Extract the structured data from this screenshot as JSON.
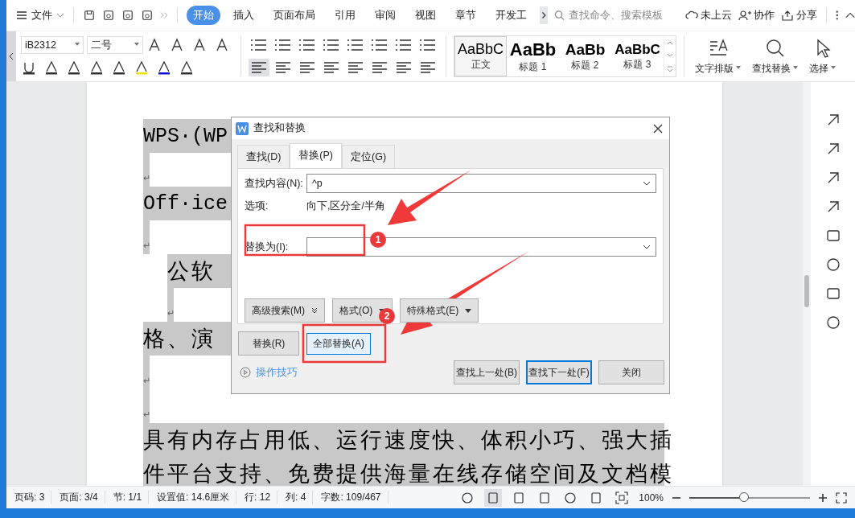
{
  "menu_bar": {
    "file_menu": "文件",
    "tabs": [
      {
        "label": "开始",
        "selected": true
      },
      {
        "label": "插入",
        "selected": false
      },
      {
        "label": "页面布局",
        "selected": false
      },
      {
        "label": "引用",
        "selected": false
      },
      {
        "label": "审阅",
        "selected": false
      },
      {
        "label": "视图",
        "selected": false
      },
      {
        "label": "章节",
        "selected": false
      },
      {
        "label": "开发工",
        "selected": false
      }
    ],
    "search": {
      "placeholder": "查找命令、搜索模板"
    },
    "actions": [
      {
        "kind": "cloud",
        "label": "未上云"
      },
      {
        "kind": "collab",
        "label": "协作"
      },
      {
        "kind": "share",
        "label": "分享"
      }
    ]
  },
  "ribbon": {
    "font_name": "iB2312",
    "font_size": "二号",
    "styles": [
      {
        "kind": "body",
        "sample": "AaBbC",
        "label": "正文",
        "selected": true
      },
      {
        "kind": "h1",
        "sample": "AaBb",
        "label": "标题 1",
        "selected": false
      },
      {
        "kind": "h2",
        "sample": "AaBb",
        "label": "标题 2",
        "selected": false
      },
      {
        "kind": "h3",
        "sample": "AaBbC",
        "label": "标题 3",
        "selected": false
      }
    ],
    "tools": [
      {
        "kind": "layout",
        "label": "文字排版"
      },
      {
        "kind": "find",
        "label": "查找替换"
      },
      {
        "kind": "select",
        "label": "选择"
      }
    ]
  },
  "document": {
    "lines": [
      {
        "kind": "latin",
        "text": "WPS·(WP"
      },
      {
        "kind": "mark",
        "text": "↵"
      },
      {
        "kind": "latin",
        "text": "Off·ice"
      },
      {
        "kind": "mark",
        "text": "↵"
      },
      {
        "kind": "indented",
        "text": "公软"
      },
      {
        "kind": "indented_mark",
        "text": "↵"
      },
      {
        "kind": "text",
        "text": "格、演"
      },
      {
        "kind": "mark",
        "text": "↵"
      },
      {
        "kind": "mark",
        "text": "↵"
      },
      {
        "kind": "text",
        "text": "具有内存占用低、运行速度快、体积小巧、强大插"
      },
      {
        "kind": "text",
        "text": "件平台支持、免费提供海量在线存储空间及文档模"
      }
    ]
  },
  "dialog": {
    "title": "查找和替换",
    "tabs": [
      {
        "label": "查找(D)",
        "selected": false
      },
      {
        "label": "替换(P)",
        "selected": true
      },
      {
        "label": "定位(G)",
        "selected": false
      }
    ],
    "find": {
      "label": "查找内容(N):",
      "value": "^p"
    },
    "options": {
      "label": "选项:",
      "value": "向下,区分全/半角"
    },
    "replace": {
      "label": "替换为(I):"
    },
    "option_buttons": [
      {
        "kind": "expand",
        "label": "高级搜索(M)"
      },
      {
        "kind": "dropdown",
        "label": "格式(O)"
      },
      {
        "kind": "dropdown",
        "label": "特殊格式(E)"
      }
    ],
    "left_buttons": [
      {
        "label": "替换(R)",
        "highlighted": false
      },
      {
        "label": "全部替换(A)",
        "highlighted": true
      }
    ],
    "tips_link": "操作技巧",
    "right_buttons": [
      {
        "label": "查找上一处(B)",
        "default": false
      },
      {
        "label": "查找下一处(F)",
        "default": true
      },
      {
        "label": "关闭",
        "default": false
      }
    ]
  },
  "annotations": [
    {
      "label": "1"
    },
    {
      "label": "2"
    }
  ],
  "status_bar": {
    "items": [
      "页码: 3",
      "页面: 3/4",
      "节: 1/1",
      "设置值: 14.6厘米",
      "行: 12",
      "列: 4",
      "字数: 109/467"
    ],
    "zoom": "100%",
    "zoom_slider": {
      "level": 0.45
    }
  }
}
